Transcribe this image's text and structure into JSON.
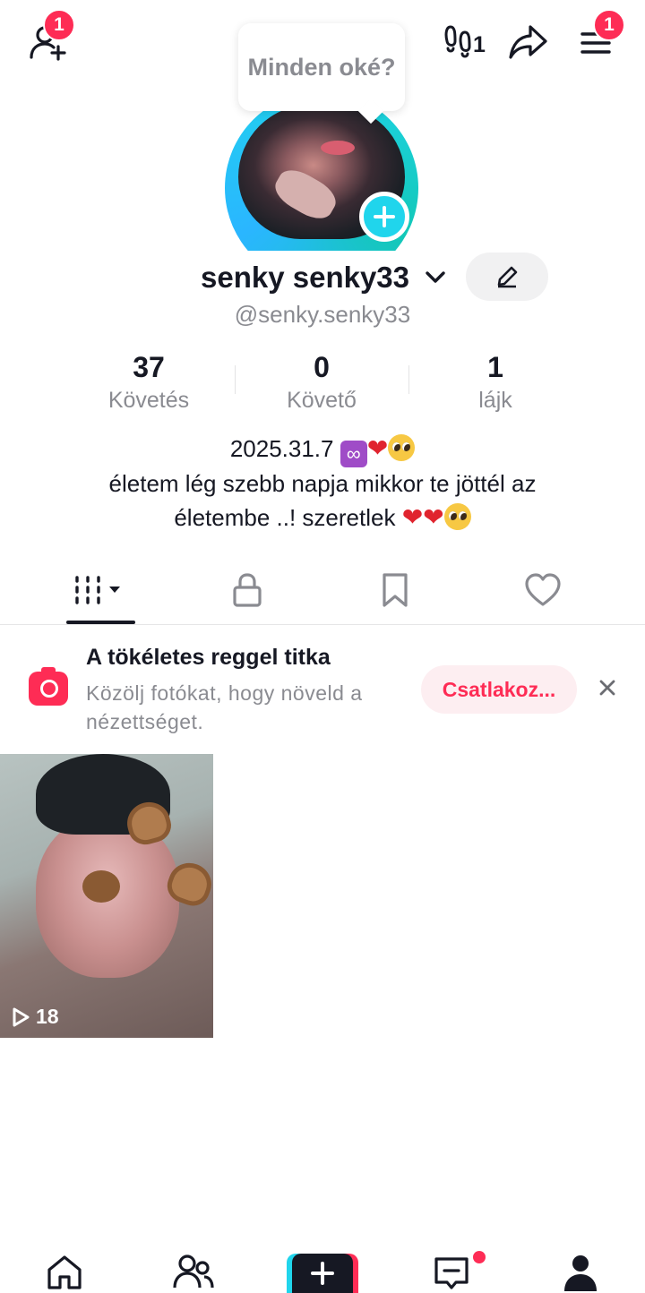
{
  "header": {
    "add_friends_badge": "1",
    "steps_count": "1",
    "menu_badge": "1",
    "status_bubble": "Minden oké?"
  },
  "profile": {
    "display_name": "senky senky33",
    "handle": "@senky.senky33",
    "stats": [
      {
        "value": "37",
        "label": "Követés"
      },
      {
        "value": "0",
        "label": "Követő"
      },
      {
        "value": "1",
        "label": "lájk"
      }
    ],
    "bio_line1": "2025.31.7",
    "bio_line2": "életem lég szebb napja mikkor te jöttél az",
    "bio_line3": "életembe ..! szeretlek"
  },
  "promo": {
    "title": "A tökéletes reggel titka",
    "description": "Közölj fotókat, hogy növeld a nézettséget.",
    "button": "Csatlakoz..."
  },
  "videos": [
    {
      "views": "18"
    }
  ],
  "icons": {
    "top": [
      "add-friend-icon",
      "footsteps-icon",
      "share-icon",
      "menu-icon"
    ],
    "tabs": [
      "videos-grid-icon",
      "lock-icon",
      "bookmark-icon",
      "heart-icon"
    ],
    "nav": [
      "home-icon",
      "friends-icon",
      "create-icon",
      "inbox-icon",
      "profile-icon"
    ]
  },
  "colors": {
    "accent_red": "#fe2c55",
    "accent_cyan": "#20d5ec",
    "text_primary": "#161823",
    "text_secondary": "#8a8b91"
  }
}
